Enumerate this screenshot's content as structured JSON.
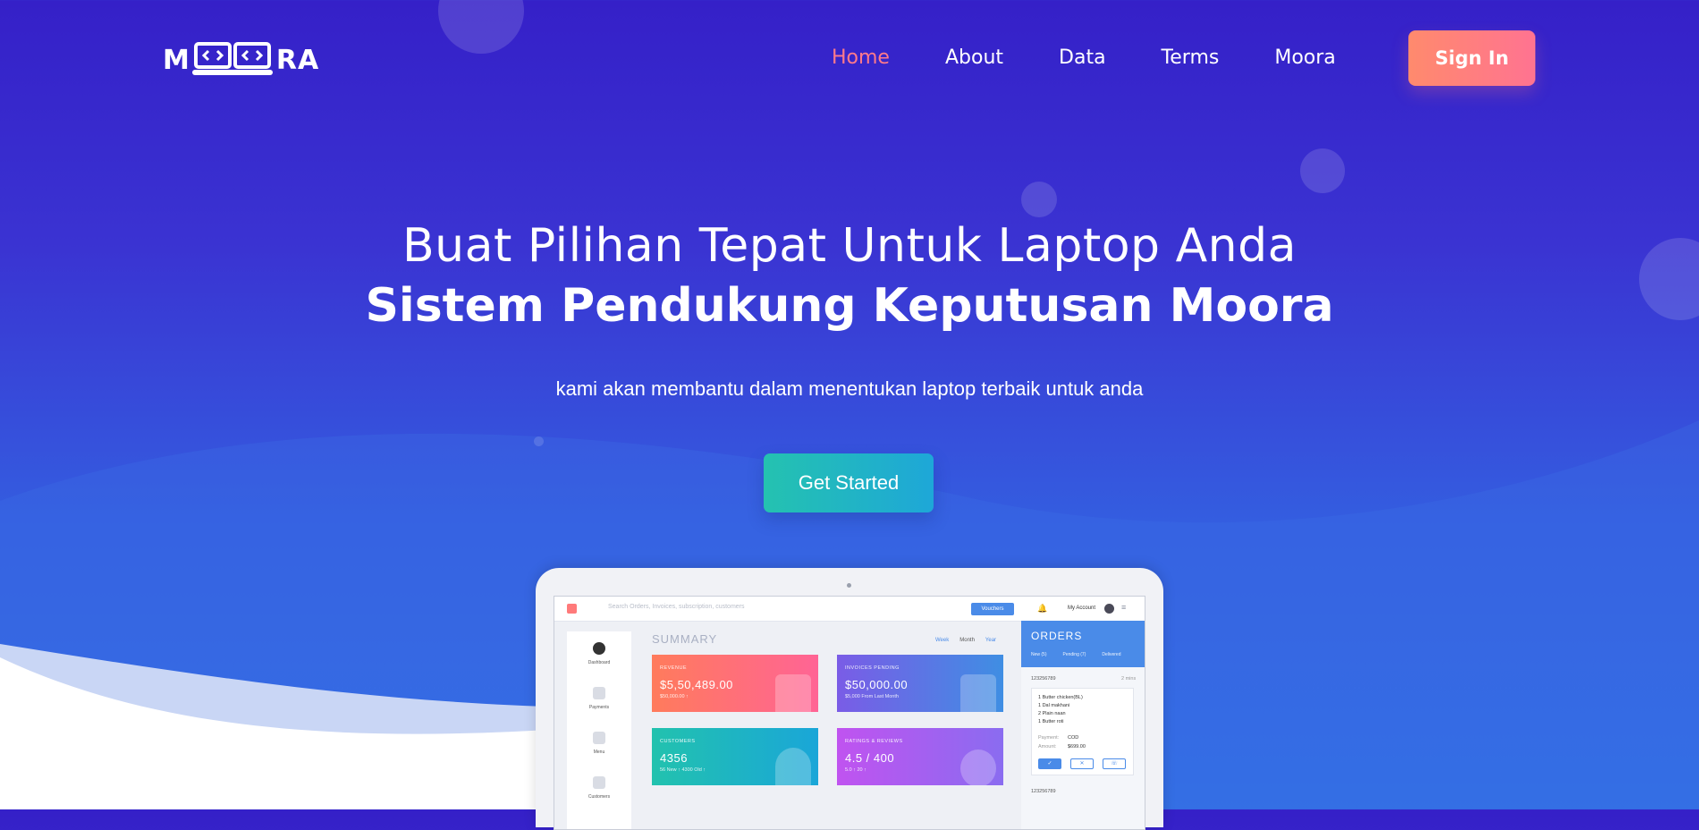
{
  "nav": {
    "logo_text_left": "M",
    "logo_text_right": "RA",
    "logo_icon": "laptop-code-icon",
    "items": [
      {
        "label": "Home",
        "active": true
      },
      {
        "label": "About",
        "active": false
      },
      {
        "label": "Data",
        "active": false
      },
      {
        "label": "Terms",
        "active": false
      },
      {
        "label": "Moora",
        "active": false
      }
    ],
    "signin_label": "Sign In"
  },
  "hero": {
    "title_line1": "Buat Pilihan Tepat Untuk Laptop Anda",
    "title_line2": "Sistem Pendukung Keputusan Moora",
    "subtitle": "kami akan membantu dalam menentukan laptop terbaik untuk anda",
    "cta_label": "Get Started"
  },
  "mockup": {
    "search_placeholder": "Search Orders, Invoices, subscription, customers",
    "voucher_label": "Vouchers",
    "account_label": "My Account",
    "sidebar": [
      "Dashboard",
      "Payments",
      "Menu",
      "Customers"
    ],
    "summary_title": "SUMMARY",
    "periods": [
      "Week",
      "Month",
      "Year"
    ],
    "cards": [
      {
        "label": "REVENUE",
        "value": "$5,50,489.00",
        "sub": "$50,000.00 ↑"
      },
      {
        "label": "INVOICES PENDING",
        "value": "$50,000.00",
        "sub": "$5,000 From Last Month"
      },
      {
        "label": "CUSTOMERS",
        "value": "4356",
        "sub": "56 New ↑      4300 Old ↑"
      },
      {
        "label": "RATINGS & REVIEWS",
        "value": "4.5 / 400",
        "sub": "5.0 ↑      20 ↑"
      }
    ],
    "orders_title": "ORDERS",
    "order_tabs": [
      "New (5)",
      "Pending (7)",
      "Delivered"
    ],
    "order1_id": "123256789",
    "order1_time": "2 mins",
    "order1_items": [
      "1 Butter chicken(BL)",
      "1 Dal makhani",
      "2 Plain naan",
      "1 Butter roti"
    ],
    "order1_payment_label": "Payment:",
    "order1_payment": "COD",
    "order1_amount_label": "Amount:",
    "order1_amount": "$699.00",
    "order2_id": "123256789"
  },
  "colors": {
    "accent_nav": "#ff7a8a",
    "signin": "#ff7e7f",
    "cta": "#1fb5c4",
    "bg_top": "#3520c8",
    "bg_bottom": "#3170e4"
  }
}
